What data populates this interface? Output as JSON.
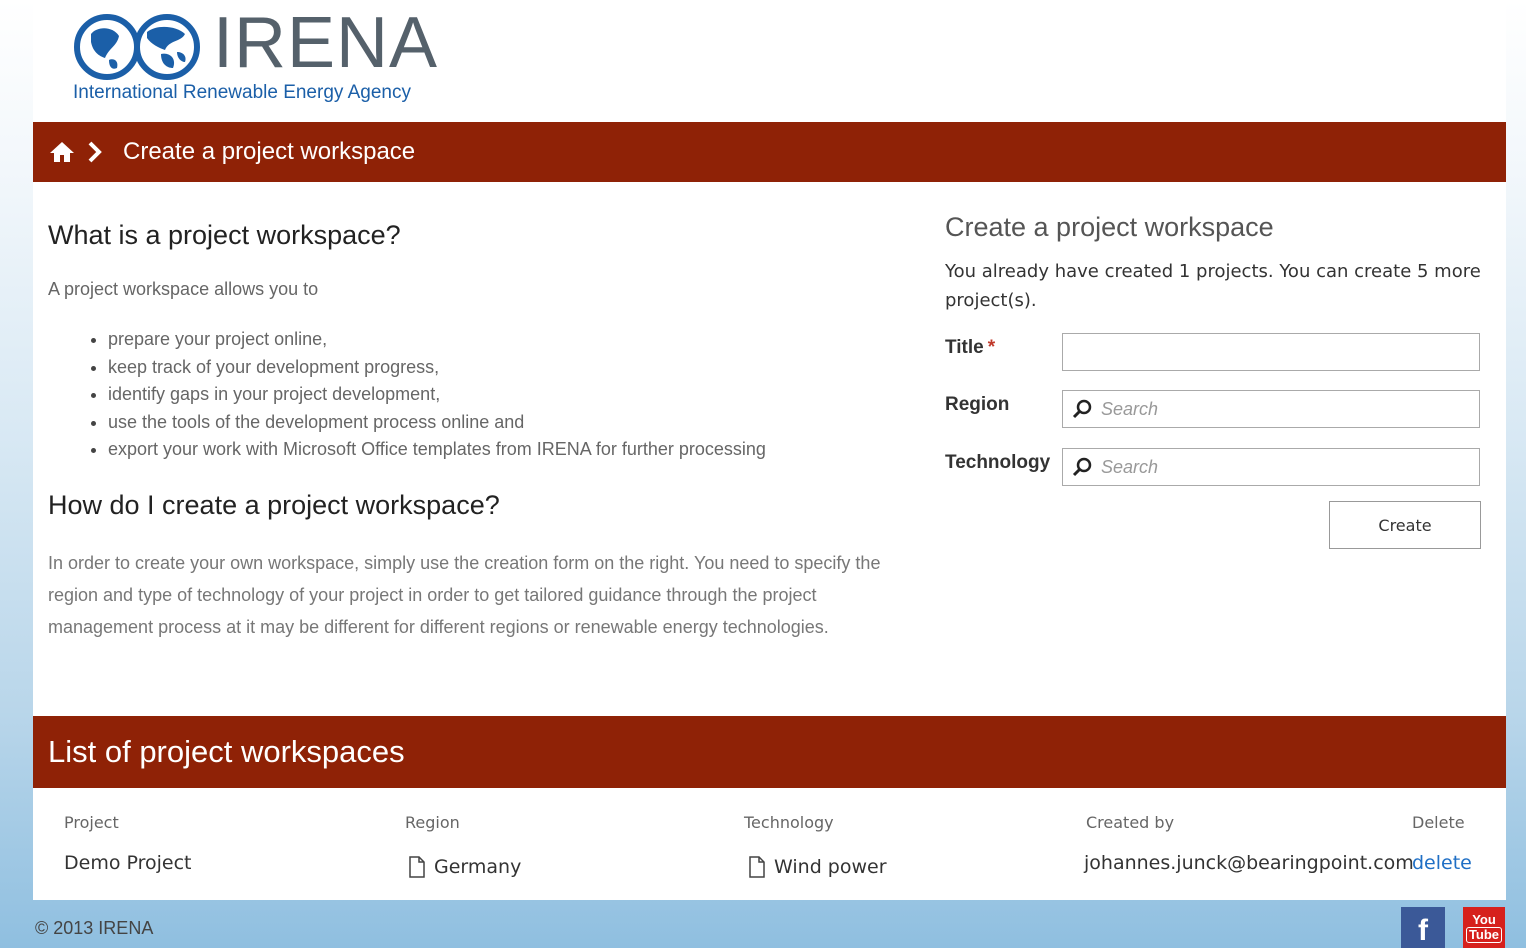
{
  "logo": {
    "wordmark": "IRENA",
    "tagline": "International Renewable Energy Agency"
  },
  "breadcrumb": {
    "current": "Create a project workspace"
  },
  "intro": {
    "title": "What is a project workspace?",
    "lead": "A project workspace allows you to",
    "bullets": [
      "prepare your project online,",
      "keep track of your development progress,",
      "identify gaps in your project development,",
      "use the tools of the development process online and",
      "export your work with Microsoft Office templates from IRENA for further processing"
    ],
    "howto_title": "How do I create a project workspace?",
    "howto_text": "In order to create your own workspace, simply use the creation form on the right. You need to specify the region and type of technology of your project in order to get tailored guidance through the project management process at it may be different for different regions or renewable energy technologies."
  },
  "form": {
    "title": "Create a project workspace",
    "info": "You already have created 1 projects. You can create 5 more project(s).",
    "title_label": "Title",
    "required_mark": "*",
    "title_value": "",
    "region_label": "Region",
    "region_placeholder": "Search",
    "technology_label": "Technology",
    "technology_placeholder": "Search",
    "create_label": "Create"
  },
  "list": {
    "title": "List of project workspaces",
    "headers": {
      "project": "Project",
      "region": "Region",
      "technology": "Technology",
      "created_by": "Created by",
      "delete": "Delete"
    },
    "rows": [
      {
        "project": "Demo Project",
        "region": "Germany",
        "technology": "Wind power",
        "created_by": "johannes.junck@bearingpoint.com",
        "delete": "delete"
      }
    ]
  },
  "footer": {
    "copyright": "© 2013 IRENA",
    "social": [
      "facebook-icon",
      "youtube-icon"
    ],
    "youtube_text": [
      "You",
      "Tube"
    ]
  },
  "colors": {
    "brand_red": "#8f2206",
    "link_blue": "#1f6fc5",
    "logo_blue": "#1b5fa8"
  }
}
